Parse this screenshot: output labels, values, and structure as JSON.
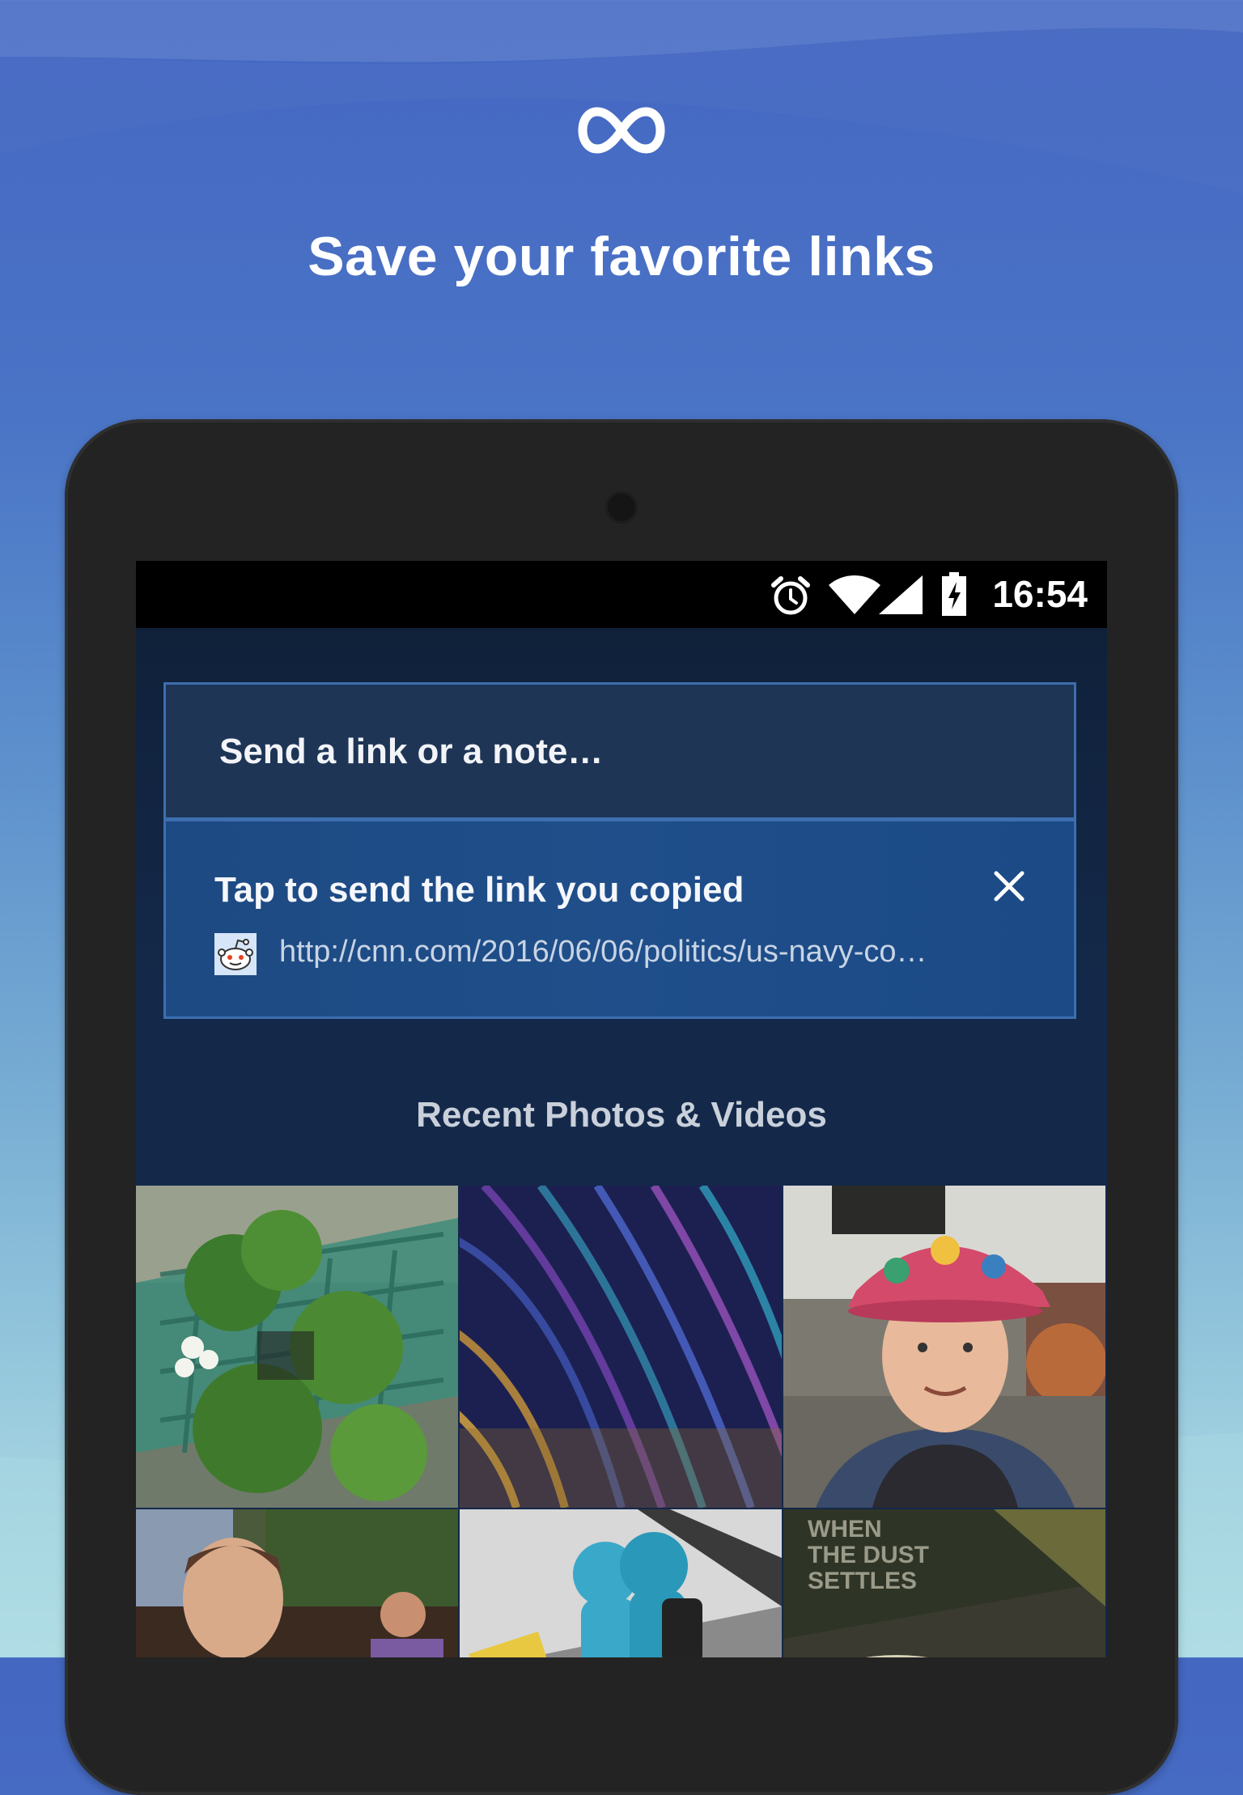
{
  "headline": "Save your favorite links",
  "status_bar": {
    "time": "16:54",
    "icons": [
      "alarm-icon",
      "wifi-icon",
      "signal-icon",
      "battery-charging-icon"
    ]
  },
  "compose": {
    "label": "Send a link or a note…"
  },
  "clipboard_suggestion": {
    "title": "Tap to send the link you copied",
    "url": "http://cnn.com/2016/06/06/politics/us-navy-co…",
    "favicon": "reddit-icon",
    "close_icon": "close-icon"
  },
  "recent": {
    "title": "Recent Photos & Videos",
    "overlay_text": "WHEN THE DUST SETTLES"
  },
  "colors": {
    "accent_border": "#3d6fb0",
    "screen_bg": "#13284a"
  }
}
